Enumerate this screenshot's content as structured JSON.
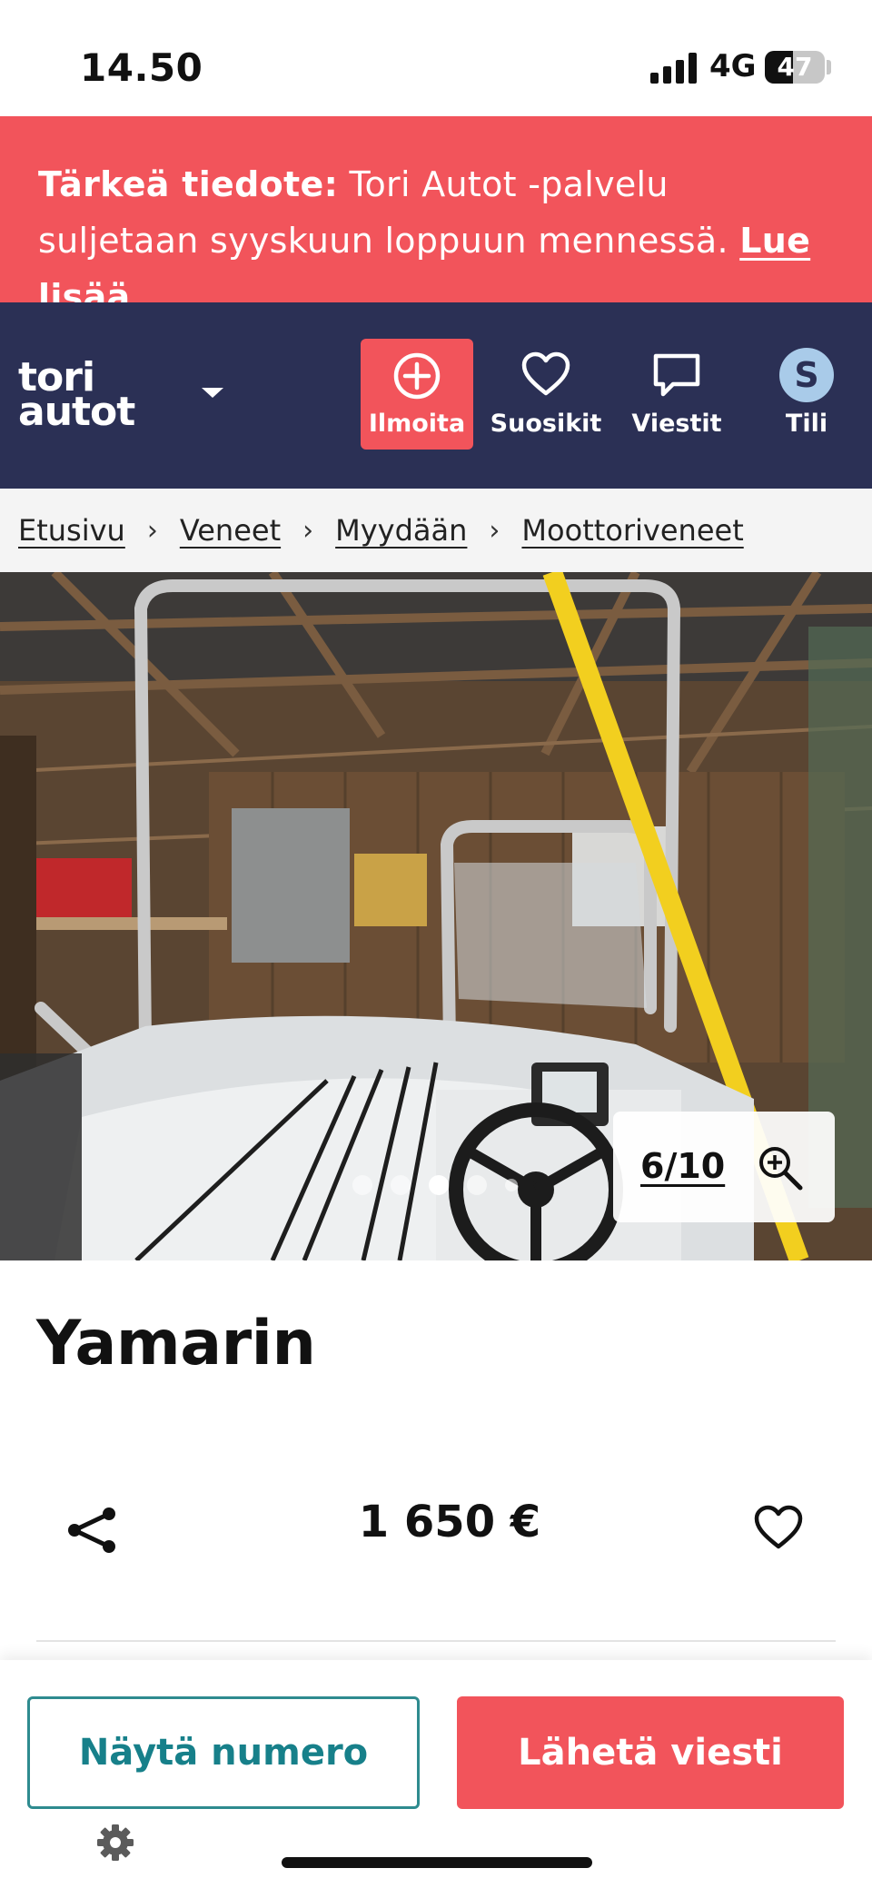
{
  "status_bar": {
    "time": "14.50",
    "network": "4G",
    "battery_percent": "47",
    "battery_level": 0.47
  },
  "notice": {
    "label": "Tärkeä tiedote:",
    "text": " Tori Autot -palvelu suljetaan syyskuun loppuun mennessä. ",
    "link": "Lue lisää"
  },
  "header": {
    "logo_line1": "tori",
    "logo_line2": "autot",
    "nav": [
      {
        "label": "Ilmoita",
        "icon": "plus-circle-icon"
      },
      {
        "label": "Suosikit",
        "icon": "heart-icon"
      },
      {
        "label": "Viestit",
        "icon": "chat-icon"
      },
      {
        "label": "Tili",
        "icon": "avatar",
        "avatar_letter": "S"
      }
    ]
  },
  "breadcrumb": [
    "Etusivu",
    "Veneet",
    "Myydään",
    "Moottoriveneet"
  ],
  "gallery": {
    "counter": "6/10",
    "dots_total": 5,
    "dots_active": 3
  },
  "listing": {
    "title": "Yamarin",
    "price": "1 650 €"
  },
  "actions": {
    "show_number": "Näytä numero",
    "send_message": "Lähetä viesti"
  },
  "colors": {
    "accent": "#f2545b",
    "header_bg": "#2b3055",
    "teal": "#17808a"
  }
}
